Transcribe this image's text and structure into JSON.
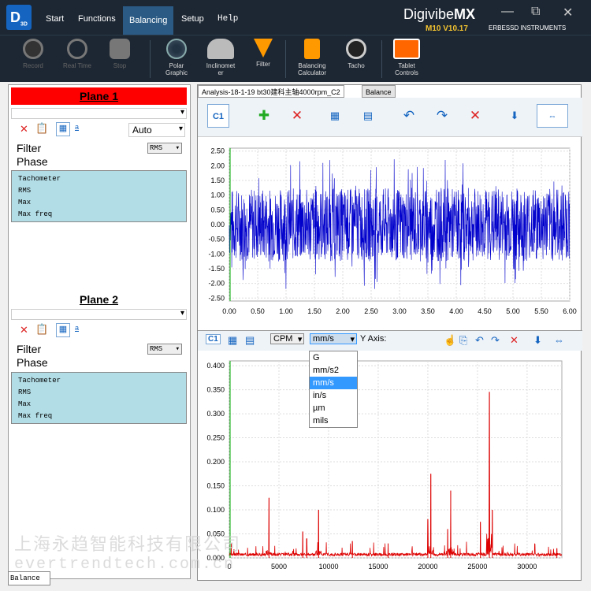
{
  "app": {
    "logo_text": "D",
    "logo_sub": "3D",
    "brand_a": "Digivibe",
    "brand_b": "MX",
    "version": "M10 V10.17",
    "company": "ERBESSD INSTRUMENTS"
  },
  "tabs": [
    {
      "label": "Start"
    },
    {
      "label": "Functions"
    },
    {
      "label": "Balancing"
    },
    {
      "label": "Setup"
    },
    {
      "label": "Help"
    }
  ],
  "window_icons": {
    "min": "—",
    "max": "⧉",
    "close": "✕"
  },
  "ribbon": [
    {
      "label": "Record",
      "enabled": false
    },
    {
      "label": "Real Time",
      "enabled": false
    },
    {
      "label": "Stop",
      "enabled": false
    },
    {
      "label": "Polar",
      "label2": "Graphic",
      "enabled": true
    },
    {
      "label": "Inclinomet",
      "label2": "er",
      "enabled": true
    },
    {
      "label": "Filter",
      "enabled": true
    },
    {
      "label": "Balancing",
      "label2": "Calculator",
      "enabled": true
    },
    {
      "label": "Tacho",
      "enabled": true
    },
    {
      "label": "Tablet",
      "label2": "Controls",
      "enabled": true
    }
  ],
  "left": {
    "plane1": "Plane 1",
    "plane2": "Plane 2",
    "auto": "Auto",
    "filter": "Filter",
    "phase": "Phase",
    "rms_select": "RMS",
    "info": [
      "Tachometer",
      "RMS",
      "Max",
      "Max freq"
    ],
    "bottom_tab": "Balance"
  },
  "right": {
    "tab1": "Analysis-18-1-19 bt30建科主轴4000rpm_C2",
    "tab2": "Balance",
    "c1": "C1",
    "cpm": "CPM",
    "unit": "mm/s",
    "yaxis": "Y Axis:",
    "dropdown": [
      "G",
      "mm/s2",
      "mm/s",
      "in/s",
      "µm",
      "mils"
    ],
    "dropdown_selected": 2
  },
  "watermark": {
    "line1": "上海永趋智能科技有限公司",
    "line2": "evertrendtech.com.cn"
  },
  "chart_data": [
    {
      "type": "line",
      "title": "",
      "xlabel": "",
      "ylabel": "",
      "xlim": [
        0,
        6
      ],
      "ylim": [
        -2.6,
        2.6
      ],
      "x_ticks": [
        "0.00",
        "0.50",
        "1.00",
        "1.50",
        "2.00",
        "2.50",
        "3.00",
        "3.50",
        "4.00",
        "4.50",
        "5.00",
        "5.50",
        "6.00"
      ],
      "y_ticks": [
        "2.50",
        "2.00",
        "1.50",
        "1.00",
        "0.50",
        "0.00",
        "-0.50",
        "-1.00",
        "-1.50",
        "-2.00",
        "-2.50"
      ],
      "series": [
        {
          "color": "#0000cc",
          "values": "random vibration noise, amplitude about ±1.5, peaks to ±2.4"
        }
      ]
    },
    {
      "type": "line",
      "title": "",
      "xlabel": "",
      "ylabel": "",
      "xlim": [
        0,
        33500
      ],
      "ylim": [
        0,
        0.41
      ],
      "x_ticks": [
        "0",
        "5000",
        "10000",
        "15000",
        "20000",
        "25000",
        "30000"
      ],
      "y_ticks": [
        "0.400",
        "0.350",
        "0.300",
        "0.250",
        "0.200",
        "0.150",
        "0.100",
        "0.050",
        "0.000"
      ],
      "peaks": [
        [
          4000,
          0.125
        ],
        [
          7400,
          0.055
        ],
        [
          7800,
          0.04
        ],
        [
          9000,
          0.1
        ],
        [
          12400,
          0.035
        ],
        [
          16000,
          0.03
        ],
        [
          20000,
          0.08
        ],
        [
          20300,
          0.175
        ],
        [
          22000,
          0.06
        ],
        [
          22300,
          0.14
        ],
        [
          25300,
          0.075
        ],
        [
          26200,
          0.345
        ],
        [
          26500,
          0.1
        ],
        [
          33000,
          0.02
        ]
      ],
      "series": [
        {
          "color": "#dd0000"
        }
      ]
    }
  ]
}
